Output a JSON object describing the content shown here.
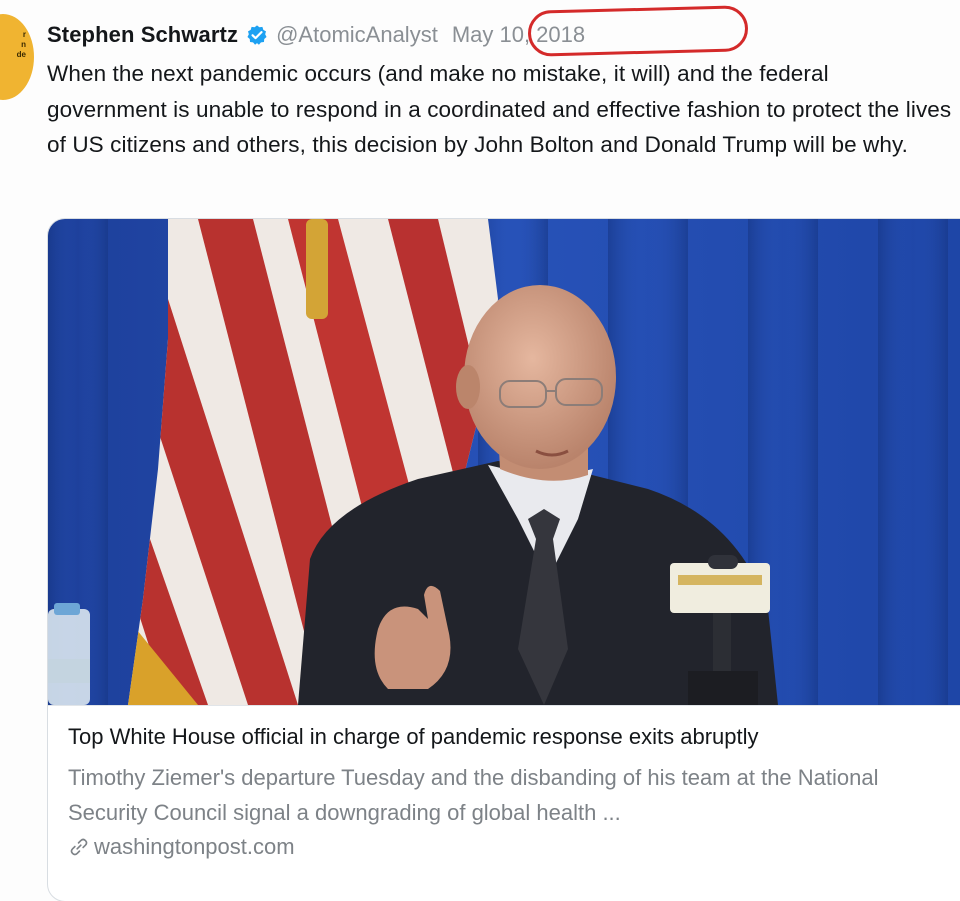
{
  "tweet": {
    "author_name": "Stephen Schwartz",
    "handle": "@AtomicAnalyst",
    "date": "May 10, 2018",
    "verified_icon": "verified-badge-icon",
    "body": "When the next pandemic occurs (and make no mistake, it will) and the federal government is unable to respond in a coordinated and effective fashion to protect the lives of US citizens and others, this decision by John Bolton and Donald Trump will be why."
  },
  "card": {
    "title": "Top White House official in charge of pandemic response exits abruptly",
    "description": "Timothy Ziemer's departure Tuesday and the disbanding of his team at the National Security Council signal a downgrading of global health ...",
    "domain": "washingtonpost.com",
    "link_icon": "link-icon"
  },
  "colors": {
    "verified_blue": "#1da1f2",
    "annotation_red": "#d42a2a",
    "avatar_yellow": "#f0b431",
    "muted_text": "#7d8287"
  }
}
